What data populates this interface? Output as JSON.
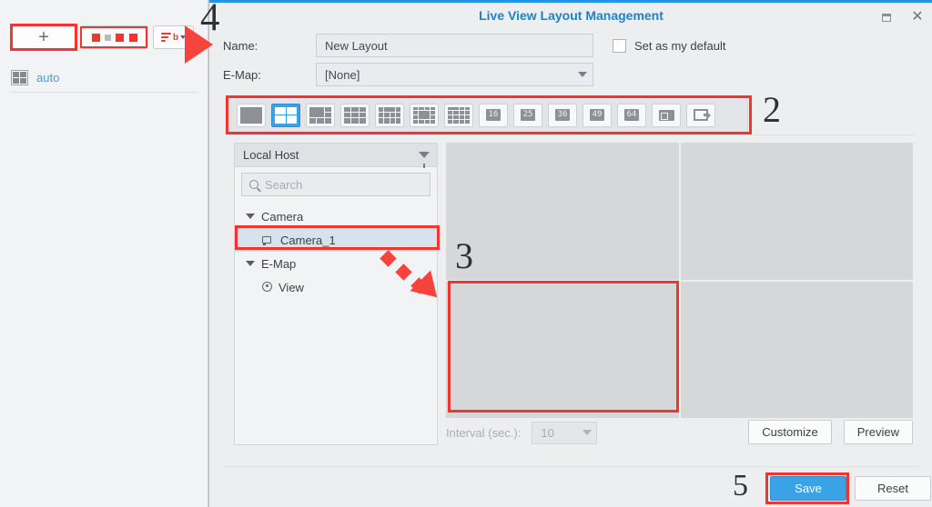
{
  "window": {
    "title": "Live View Layout Management",
    "restore_icon": "restore-window-icon",
    "close_icon": "close-icon"
  },
  "sidebar": {
    "toolbar": {
      "add_label": "+",
      "add_icon": "plus-icon",
      "edit_icon": "edit-icon",
      "sort_icon": "sort-icon"
    },
    "items": [
      {
        "label": "auto",
        "icon": "grid-2x2-icon"
      }
    ]
  },
  "form": {
    "name_label": "Name:",
    "name_value": "New Layout",
    "name_placeholder": "New Layout",
    "emap_label": "E-Map:",
    "emap_value": "[None]",
    "default_checkbox_label": "Set as my default",
    "default_checked": false
  },
  "layout_bar": {
    "options": [
      {
        "name": "layout-1",
        "type": "grid",
        "cols": 1,
        "rows": 1,
        "selected": false
      },
      {
        "name": "layout-4",
        "type": "grid",
        "cols": 2,
        "rows": 2,
        "selected": true
      },
      {
        "name": "layout-6-featured",
        "type": "custom",
        "selected": false
      },
      {
        "name": "layout-9",
        "type": "grid",
        "cols": 3,
        "rows": 3,
        "selected": false
      },
      {
        "name": "layout-10-wide",
        "type": "custom",
        "selected": false
      },
      {
        "name": "layout-13-center",
        "type": "custom",
        "selected": false
      },
      {
        "name": "layout-12",
        "type": "grid",
        "cols": 4,
        "rows": 3,
        "selected": false
      }
    ],
    "numeric_options": [
      {
        "name": "layout-16",
        "label": "16"
      },
      {
        "name": "layout-25",
        "label": "25"
      },
      {
        "name": "layout-36",
        "label": "36"
      },
      {
        "name": "layout-49",
        "label": "49"
      },
      {
        "name": "layout-64",
        "label": "64"
      }
    ],
    "camera_button": {
      "name": "camera-layout-icon"
    },
    "export_button": {
      "name": "export-layout-icon"
    }
  },
  "source_tree": {
    "header": "Local Host",
    "filter_icon": "filter-funnel-icon",
    "search_placeholder": "Search",
    "search_value": "",
    "nodes": [
      {
        "label": "Camera",
        "level": 0,
        "icon": "expand-triangle-icon",
        "selected": false
      },
      {
        "label": "Camera_1",
        "level": 1,
        "icon": "camera-icon",
        "selected": true
      },
      {
        "label": "E-Map",
        "level": 0,
        "icon": "expand-triangle-icon",
        "selected": false
      },
      {
        "label": "View",
        "level": 1,
        "icon": "map-pin-icon",
        "selected": false
      }
    ]
  },
  "preview": {
    "cells": [
      {
        "name": "preview-cell-1",
        "highlighted": false
      },
      {
        "name": "preview-cell-2",
        "highlighted": false
      },
      {
        "name": "preview-cell-3",
        "highlighted": true
      },
      {
        "name": "preview-cell-4",
        "highlighted": false
      }
    ],
    "interval_label": "Interval (sec.):",
    "interval_value": "10",
    "customize_label": "Customize",
    "preview_label": "Preview"
  },
  "footer": {
    "save_label": "Save",
    "reset_label": "Reset"
  },
  "annotations": {
    "step2": "2",
    "step3": "3",
    "step4": "4",
    "step5": "5",
    "highlight_color": "#f6342f",
    "arrow_color": "#f6443d"
  }
}
